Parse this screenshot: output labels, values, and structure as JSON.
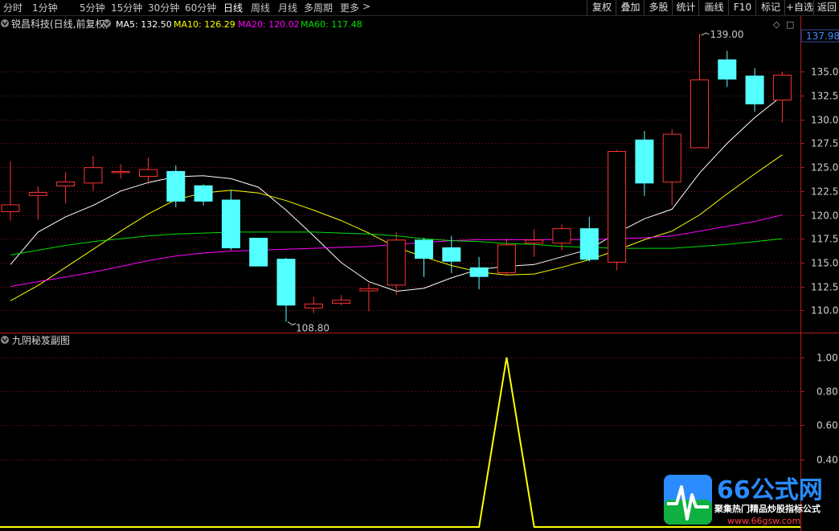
{
  "toolbar": {
    "timeframes": [
      "分时",
      "1分钟",
      "5分钟",
      "15分钟",
      "30分钟",
      "60分钟",
      "日线",
      "周线",
      "月线",
      "多周期",
      "更多"
    ],
    "active": "日线",
    "more_arrow": ">",
    "buttons": [
      "复权",
      "叠加",
      "多股",
      "统计",
      "画线",
      "F10",
      "标记",
      "+自选",
      "返回"
    ]
  },
  "main_panel": {
    "title": "锐昌科技(日线,前复权)",
    "ma_labels": [
      {
        "text": "MA5: 132.50",
        "color": "#ffffff"
      },
      {
        "text": "MA10: 126.29",
        "color": "#ffff00"
      },
      {
        "text": "MA20: 120.02",
        "color": "#ff00ff"
      },
      {
        "text": "MA60: 117.48",
        "color": "#00e000"
      }
    ],
    "current_price": "137.98",
    "y_ticks": [
      "135.0",
      "132.5",
      "130.0",
      "127.5",
      "125.0",
      "122.5",
      "120.0",
      "117.5",
      "115.0",
      "112.5",
      "110.0"
    ],
    "max_label": "139.00",
    "min_label": "108.80",
    "diamond_icon": "◇",
    "window_icon": "□"
  },
  "sub_panel": {
    "title": "九阴秘笈副图",
    "y_ticks": [
      "1.00",
      "0.80",
      "0.60",
      "0.40"
    ]
  },
  "watermark": {
    "logo_text": "66公式网",
    "slogan": "聚集热门精品炒股指标公式",
    "url": "www.66gsw.com"
  },
  "chart_data": [
    {
      "type": "candlestick",
      "title": "锐昌科技(日线,前复权)",
      "ylim": [
        108.0,
        139.5
      ],
      "up_color": "#ff3232",
      "down_color": "#54ffff",
      "candles": [
        {
          "o": 120.3,
          "h": 125.6,
          "l": 119.4,
          "c": 121.1
        },
        {
          "o": 122.0,
          "h": 123.0,
          "l": 119.5,
          "c": 122.4
        },
        {
          "o": 123.0,
          "h": 124.5,
          "l": 121.2,
          "c": 123.5
        },
        {
          "o": 123.3,
          "h": 126.2,
          "l": 122.5,
          "c": 125.0
        },
        {
          "o": 124.4,
          "h": 125.3,
          "l": 123.8,
          "c": 124.6
        },
        {
          "o": 124.0,
          "h": 126.0,
          "l": 123.2,
          "c": 124.8
        },
        {
          "o": 124.6,
          "h": 125.2,
          "l": 120.8,
          "c": 121.4
        },
        {
          "o": 123.1,
          "h": 123.2,
          "l": 121.0,
          "c": 121.4
        },
        {
          "o": 121.6,
          "h": 122.6,
          "l": 116.3,
          "c": 116.5
        },
        {
          "o": 117.6,
          "h": 117.6,
          "l": 114.6,
          "c": 114.6
        },
        {
          "o": 115.4,
          "h": 115.5,
          "l": 108.8,
          "c": 110.5
        },
        {
          "o": 110.2,
          "h": 111.4,
          "l": 109.7,
          "c": 110.7
        },
        {
          "o": 110.7,
          "h": 111.6,
          "l": 110.5,
          "c": 111.1
        },
        {
          "o": 112.0,
          "h": 112.8,
          "l": 109.9,
          "c": 112.3
        },
        {
          "o": 112.6,
          "h": 118.2,
          "l": 111.6,
          "c": 117.4
        },
        {
          "o": 117.4,
          "h": 117.6,
          "l": 113.5,
          "c": 115.4
        },
        {
          "o": 116.6,
          "h": 117.8,
          "l": 113.9,
          "c": 115.1
        },
        {
          "o": 114.5,
          "h": 115.6,
          "l": 112.2,
          "c": 113.5
        },
        {
          "o": 113.9,
          "h": 117.5,
          "l": 113.6,
          "c": 116.9
        },
        {
          "o": 117.0,
          "h": 118.5,
          "l": 115.6,
          "c": 117.4
        },
        {
          "o": 117.0,
          "h": 119.0,
          "l": 116.3,
          "c": 118.6
        },
        {
          "o": 118.6,
          "h": 119.8,
          "l": 115.1,
          "c": 115.3
        },
        {
          "o": 115.0,
          "h": 126.8,
          "l": 114.2,
          "c": 126.7
        },
        {
          "o": 127.9,
          "h": 128.8,
          "l": 122.0,
          "c": 123.3
        },
        {
          "o": 123.4,
          "h": 129.0,
          "l": 121.0,
          "c": 128.5
        },
        {
          "o": 127.0,
          "h": 139.0,
          "l": 127.0,
          "c": 134.2
        },
        {
          "o": 136.3,
          "h": 137.2,
          "l": 133.4,
          "c": 134.2
        },
        {
          "o": 134.6,
          "h": 135.4,
          "l": 130.8,
          "c": 131.6
        },
        {
          "o": 132.0,
          "h": 135.0,
          "l": 129.7,
          "c": 134.7
        }
      ],
      "series": [
        {
          "name": "MA5",
          "color": "#ffffff",
          "values": [
            114.8,
            118.2,
            119.8,
            121.0,
            122.5,
            123.4,
            124.0,
            124.1,
            123.8,
            122.9,
            120.5,
            117.8,
            115.0,
            113.0,
            112.0,
            112.3,
            113.4,
            114.3,
            114.6,
            114.8,
            115.6,
            116.4,
            118.1,
            119.6,
            120.6,
            124.4,
            127.5,
            130.2,
            132.5
          ]
        },
        {
          "name": "MA10",
          "color": "#ffff00",
          "values": [
            111.0,
            112.6,
            114.5,
            116.4,
            118.3,
            120.1,
            121.6,
            122.3,
            122.6,
            122.3,
            121.5,
            120.5,
            119.4,
            118.1,
            116.6,
            115.6,
            114.7,
            114.0,
            113.7,
            113.8,
            114.5,
            115.3,
            116.3,
            117.4,
            118.3,
            120.0,
            122.2,
            124.3,
            126.3
          ]
        },
        {
          "name": "MA20",
          "color": "#ff00ff",
          "values": [
            112.5,
            113.0,
            113.5,
            114.0,
            114.6,
            115.2,
            115.7,
            116.0,
            116.2,
            116.3,
            116.4,
            116.5,
            116.6,
            116.7,
            116.9,
            117.1,
            117.3,
            117.4,
            117.4,
            117.4,
            117.4,
            117.4,
            117.5,
            117.6,
            117.8,
            118.3,
            118.8,
            119.3,
            120.0
          ]
        },
        {
          "name": "MA60",
          "color": "#00e000",
          "values": [
            115.8,
            116.3,
            116.8,
            117.2,
            117.5,
            117.8,
            118.0,
            118.1,
            118.2,
            118.2,
            118.2,
            118.2,
            118.1,
            118.0,
            117.8,
            117.5,
            117.3,
            117.2,
            117.0,
            116.9,
            116.7,
            116.6,
            116.5,
            116.5,
            116.5,
            116.7,
            116.9,
            117.2,
            117.5
          ]
        }
      ]
    },
    {
      "type": "line",
      "title": "九阴秘笈副图",
      "ylim": [
        0.0,
        1.08
      ],
      "series": [
        {
          "color": "#ffff00",
          "values": [
            0,
            0,
            0,
            0,
            0,
            0,
            0,
            0,
            0,
            0,
            0,
            0,
            0,
            0,
            0,
            0,
            0,
            0,
            1,
            0,
            0,
            0,
            0,
            0,
            0,
            0,
            0,
            0,
            0
          ]
        }
      ]
    }
  ]
}
